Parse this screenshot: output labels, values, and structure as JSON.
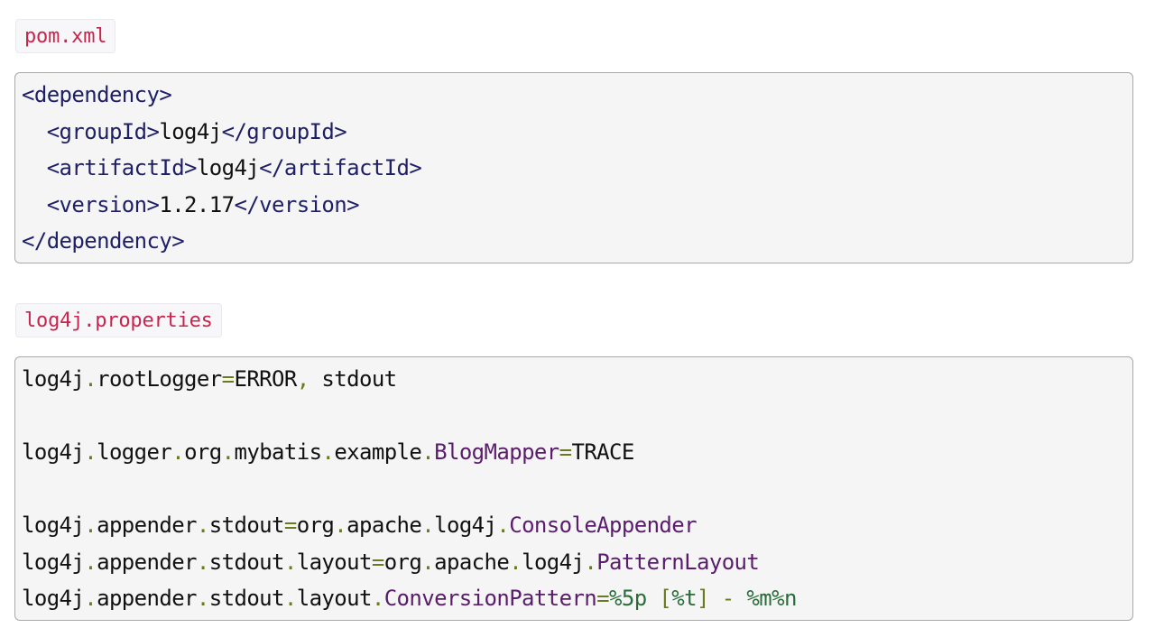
{
  "pom_label": "pom.xml",
  "xml_lines": [
    {
      "open": "<dependency>",
      "value": "",
      "close": "",
      "indent": ""
    },
    {
      "open": "<groupId>",
      "value": "log4j",
      "close": "</groupId>",
      "indent": "  "
    },
    {
      "open": "<artifactId>",
      "value": "log4j",
      "close": "</artifactId>",
      "indent": "  "
    },
    {
      "open": "<version>",
      "value": "1.2.17",
      "close": "</version>",
      "indent": "  "
    },
    {
      "open": "</dependency>",
      "value": "",
      "close": "",
      "indent": ""
    }
  ],
  "properties_label": "log4j.properties",
  "prop_lines": [
    "log4j.rootLogger=ERROR, stdout",
    "",
    "log4j.logger.org.mybatis.example.BlogMapper=TRACE",
    "",
    "log4j.appender.stdout=org.apache.log4j.ConsoleAppender",
    "log4j.appender.stdout.layout=org.apache.log4j.PatternLayout",
    "log4j.appender.stdout.layout.ConversionPattern=%5p [%t] - %m%n"
  ],
  "colors": {
    "label_text": "#c7254e",
    "code_background": "#f5f5f5",
    "xml_tag": "#1f1f66",
    "punctuation": "#6b7a1e",
    "class_name": "#5a1d6b"
  }
}
